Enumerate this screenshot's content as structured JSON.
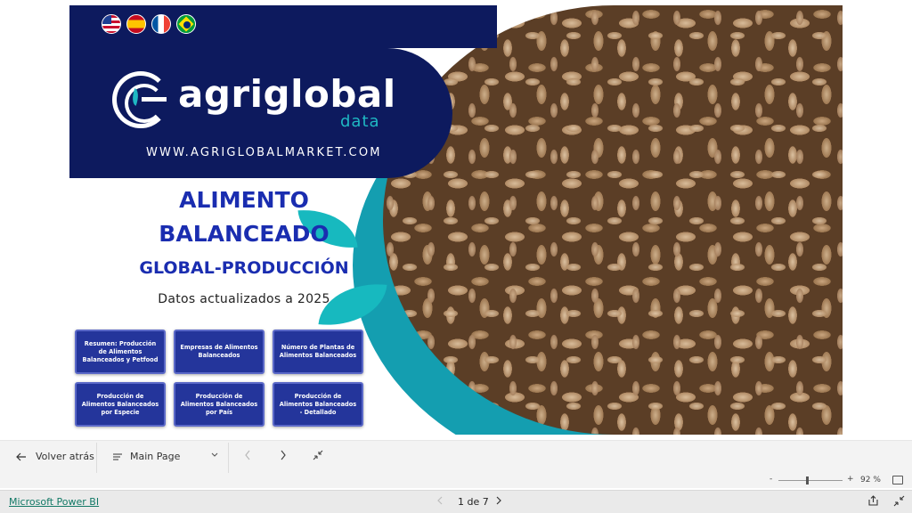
{
  "report": {
    "flags": [
      {
        "name": "us-flag-icon"
      },
      {
        "name": "spain-flag-icon"
      },
      {
        "name": "france-flag-icon"
      },
      {
        "name": "brazil-flag-icon"
      }
    ],
    "logo_word": "agriglobal",
    "logo_sub": "data",
    "website": "WWW.AGRIGLOBALMARKET.COM",
    "title_line1": "ALIMENTO",
    "title_line2": "BALANCEADO",
    "title_line3": "GLOBAL-PRODUCCIÓN",
    "updated": "Datos actualizados a 2025",
    "nav_buttons": [
      "Resumen: Producción de Alimentos Balanceados y Petfood",
      "Empresas de Alimentos Balanceados",
      "Número de Plantas de Alimentos Balanceados",
      "Producción de Alimentos Balanceados por Especie",
      "Producción de Alimentos Balanceados por País",
      "Producción de Alimentos Balanceados - Detallado"
    ],
    "colors": {
      "navy": "#0d1a5e",
      "teal": "#17b9bf",
      "title_blue": "#1a2db0",
      "button_blue": "#24359b"
    }
  },
  "navbar": {
    "back_label": "Volver atrás",
    "page_label": "Main Page"
  },
  "zoom": {
    "minus": "-",
    "plus": "+",
    "percent": "92 %",
    "level": 0.92
  },
  "footer": {
    "brand_link": "Microsoft Power BI",
    "page_indicator": "1 de 7",
    "link_color": "#117865"
  }
}
